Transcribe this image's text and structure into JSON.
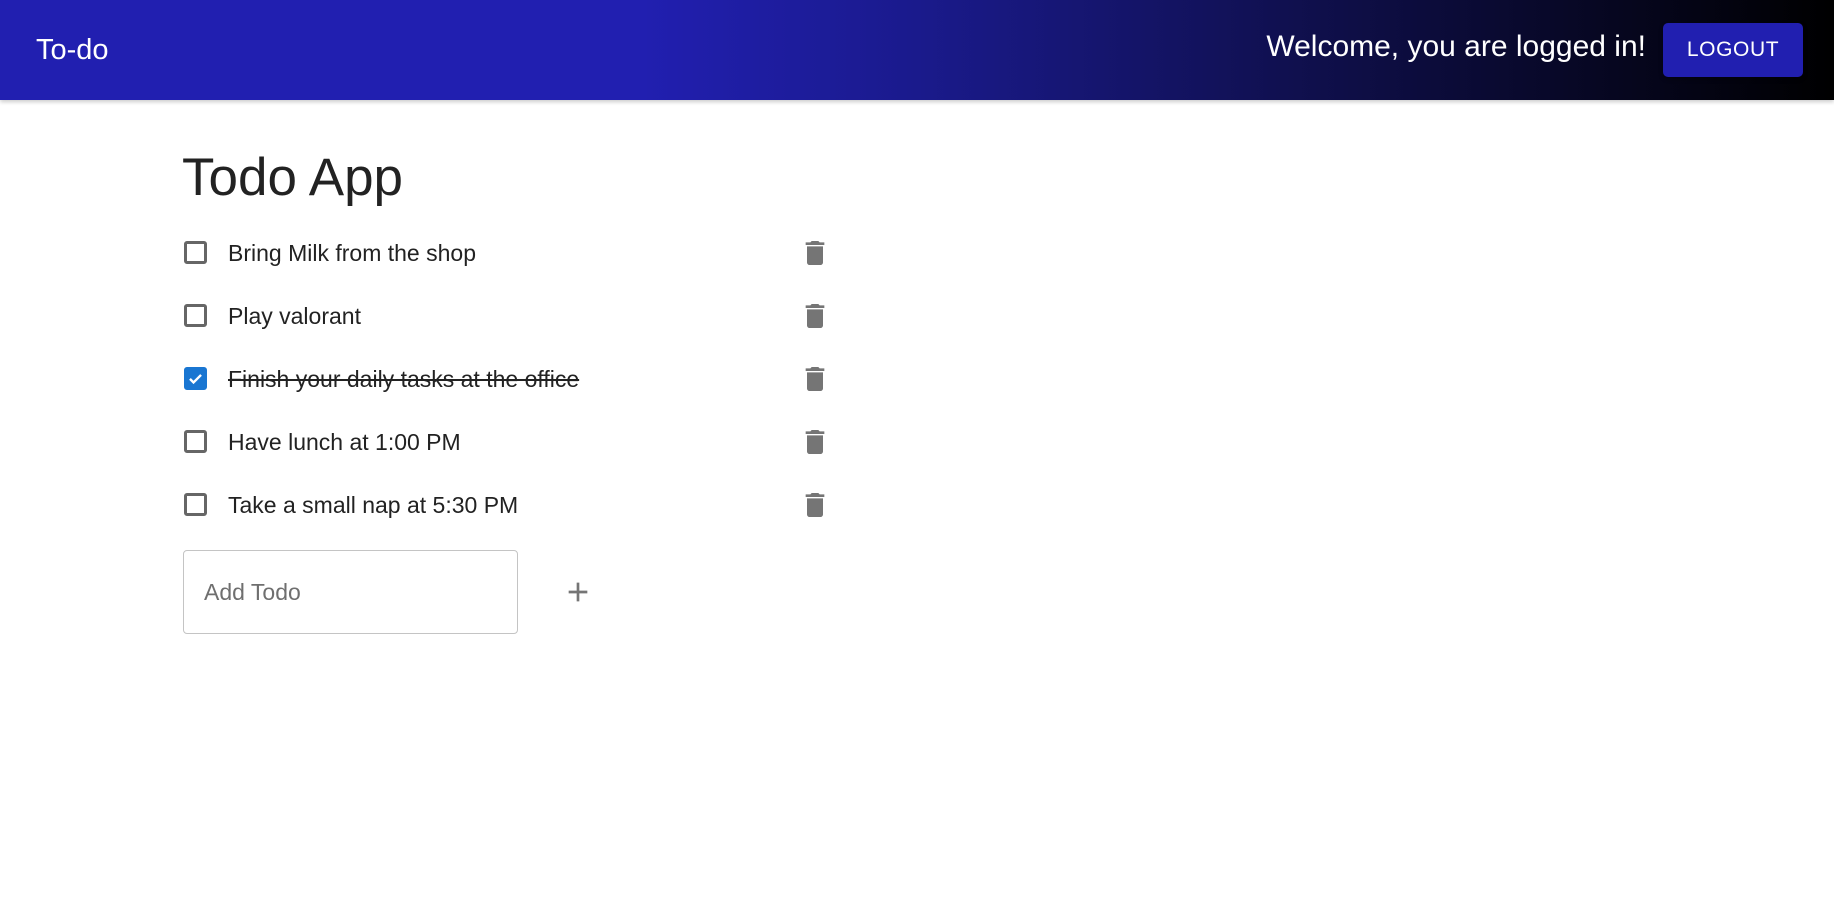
{
  "appbar": {
    "brand": "To-do",
    "welcome": "Welcome, you are logged in!",
    "logout_label": "LOGOUT",
    "gradient_colors": [
      "#211fb0",
      "#000000"
    ]
  },
  "main": {
    "title": "Todo App",
    "todos": [
      {
        "text": "Bring Milk from the shop",
        "completed": false
      },
      {
        "text": "Play valorant",
        "completed": false
      },
      {
        "text": "Finish your daily tasks at the office",
        "completed": true
      },
      {
        "text": "Have lunch at 1:00 PM",
        "completed": false
      },
      {
        "text": "Take a small nap at 5:30 PM",
        "completed": false
      }
    ],
    "delete_icon": "trash-icon",
    "add": {
      "placeholder": "Add Todo",
      "value": "",
      "button_icon": "plus-icon"
    }
  },
  "colors": {
    "checkbox_checked": "#1976d2",
    "icon_gray": "#757575"
  }
}
